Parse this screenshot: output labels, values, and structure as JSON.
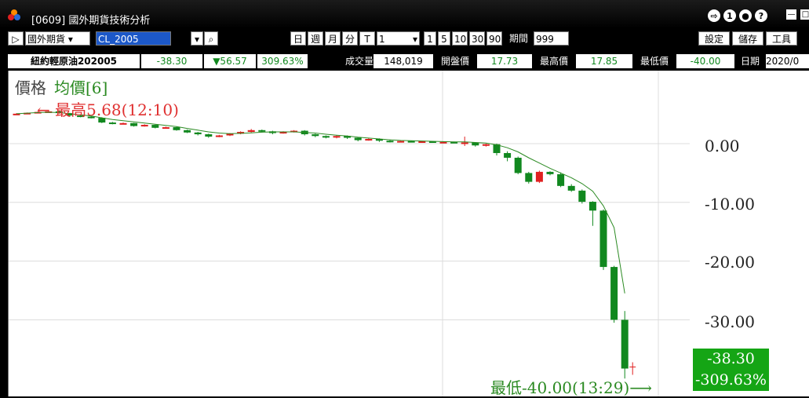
{
  "window": {
    "title": "[0609] 國外期貨技術分析",
    "help_label": "?",
    "info_label": "1",
    "minimize_label": "—"
  },
  "toolbar": {
    "market_select": "國外期貨",
    "symbol_input": "CL_2005",
    "period_buttons": [
      "日",
      "週",
      "月",
      "分",
      "T"
    ],
    "interval_value": "1",
    "minute_buttons": [
      "1",
      "5",
      "10",
      "30",
      "90"
    ],
    "range_label": "期間",
    "range_value": "999",
    "settings_label": "設定",
    "save_label": "儲存",
    "tools_label": "工具"
  },
  "quote": {
    "name": "紐約輕原油202005",
    "last": "-38.30",
    "change": "▼56.57",
    "change_pct": "309.63%",
    "volume_label": "成交量",
    "volume": "148,019",
    "open_label": "開盤價",
    "open": "17.73",
    "high_label": "最高價",
    "high": "17.85",
    "low_label": "最低價",
    "low": "-40.00",
    "date_label": "日期",
    "date": "2020/0"
  },
  "chart_title": {
    "price": "價格",
    "ma": "均價[6]"
  },
  "annotations": {
    "high": "← 最高5.68(12:10)",
    "low": "最低-40.00(13:29)⟶"
  },
  "badge": {
    "price": "-38.30",
    "pct": "-309.63%"
  },
  "colors": {
    "up": "#e02020",
    "down": "#11881f",
    "ma": "#2b8a22",
    "badge": "#15a515"
  },
  "chart_data": {
    "type": "candlestick",
    "title": "價格",
    "ma_label": "均價[6]",
    "y_ticks": [
      "0.00",
      "-10.00",
      "-20.00",
      "-30.00"
    ],
    "ylim": [
      -42,
      9
    ],
    "grid": "vertical",
    "high": 5.68,
    "high_time": "12:10",
    "low": -40.0,
    "low_time": "13:29",
    "last": -38.3,
    "candles": [
      {
        "o": 5.1,
        "c": 5.1,
        "h": 5.2,
        "l": 5.0
      },
      {
        "o": 5.2,
        "c": 5.25,
        "h": 5.3,
        "l": 5.15
      },
      {
        "o": 5.3,
        "c": 5.4,
        "h": 5.5,
        "l": 5.2
      },
      {
        "o": 5.4,
        "c": 5.5,
        "h": 5.68,
        "l": 5.3
      },
      {
        "o": 5.5,
        "c": 5.2,
        "h": 5.55,
        "l": 5.1
      },
      {
        "o": 5.2,
        "c": 4.8,
        "h": 5.25,
        "l": 4.6
      },
      {
        "o": 4.8,
        "c": 4.6,
        "h": 4.9,
        "l": 4.5
      },
      {
        "o": 4.6,
        "c": 4.4,
        "h": 4.7,
        "l": 4.3
      },
      {
        "o": 4.4,
        "c": 3.6,
        "h": 4.5,
        "l": 3.5
      },
      {
        "o": 3.6,
        "c": 3.4,
        "h": 3.7,
        "l": 3.3
      },
      {
        "o": 3.4,
        "c": 3.5,
        "h": 3.6,
        "l": 3.3
      },
      {
        "o": 3.5,
        "c": 3.0,
        "h": 3.55,
        "l": 2.9
      },
      {
        "o": 3.0,
        "c": 3.2,
        "h": 3.3,
        "l": 2.9
      },
      {
        "o": 3.2,
        "c": 2.7,
        "h": 3.25,
        "l": 2.6
      },
      {
        "o": 2.7,
        "c": 2.8,
        "h": 2.9,
        "l": 2.6
      },
      {
        "o": 2.8,
        "c": 2.3,
        "h": 2.85,
        "l": 2.2
      },
      {
        "o": 2.3,
        "c": 1.9,
        "h": 2.4,
        "l": 1.8
      },
      {
        "o": 1.9,
        "c": 1.6,
        "h": 2.0,
        "l": 1.4
      },
      {
        "o": 1.6,
        "c": 1.2,
        "h": 1.7,
        "l": 1.0
      },
      {
        "o": 1.2,
        "c": 1.4,
        "h": 1.5,
        "l": 1.1
      },
      {
        "o": 1.4,
        "c": 1.7,
        "h": 1.8,
        "l": 1.3
      },
      {
        "o": 1.7,
        "c": 2.0,
        "h": 2.1,
        "l": 1.6
      },
      {
        "o": 2.0,
        "c": 2.3,
        "h": 2.5,
        "l": 1.9
      },
      {
        "o": 2.3,
        "c": 2.1,
        "h": 2.4,
        "l": 1.9
      },
      {
        "o": 2.1,
        "c": 1.8,
        "h": 2.2,
        "l": 1.6
      },
      {
        "o": 1.8,
        "c": 2.0,
        "h": 2.1,
        "l": 1.7
      },
      {
        "o": 2.0,
        "c": 2.2,
        "h": 2.3,
        "l": 1.9
      },
      {
        "o": 2.2,
        "c": 1.6,
        "h": 2.3,
        "l": 1.4
      },
      {
        "o": 1.6,
        "c": 1.3,
        "h": 1.7,
        "l": 1.1
      },
      {
        "o": 1.3,
        "c": 1.1,
        "h": 1.4,
        "l": 0.9
      },
      {
        "o": 1.1,
        "c": 1.3,
        "h": 1.4,
        "l": 0.9
      },
      {
        "o": 1.3,
        "c": 1.0,
        "h": 1.4,
        "l": 0.8
      },
      {
        "o": 1.0,
        "c": 0.6,
        "h": 1.1,
        "l": 0.4
      },
      {
        "o": 0.6,
        "c": 0.8,
        "h": 0.9,
        "l": 0.5
      },
      {
        "o": 0.8,
        "c": 0.5,
        "h": 0.9,
        "l": 0.3
      },
      {
        "o": 0.5,
        "c": 0.3,
        "h": 0.6,
        "l": 0.2
      },
      {
        "o": 0.3,
        "c": 0.45,
        "h": 0.5,
        "l": 0.2
      },
      {
        "o": 0.45,
        "c": 0.35,
        "h": 0.5,
        "l": 0.25
      },
      {
        "o": 0.35,
        "c": 0.4,
        "h": 0.45,
        "l": 0.3
      },
      {
        "o": 0.4,
        "c": 0.25,
        "h": 0.45,
        "l": 0.2
      },
      {
        "o": 0.25,
        "c": 0.3,
        "h": 0.4,
        "l": 0.2
      },
      {
        "o": 0.3,
        "c": 0.15,
        "h": 0.35,
        "l": 0.1
      },
      {
        "o": 0.15,
        "c": 0.2,
        "h": 1.2,
        "l": -0.4
      },
      {
        "o": 0.2,
        "c": -0.3,
        "h": 0.25,
        "l": -0.5
      },
      {
        "o": -0.3,
        "c": -0.1,
        "h": 0.0,
        "l": -0.5
      },
      {
        "o": -0.1,
        "c": -1.6,
        "h": 0.0,
        "l": -2.0
      },
      {
        "o": -1.6,
        "c": -2.4,
        "h": -1.3,
        "l": -3.0
      },
      {
        "o": -2.4,
        "c": -5.0,
        "h": -2.2,
        "l": -5.2
      },
      {
        "o": -5.0,
        "c": -6.5,
        "h": -4.8,
        "l": -6.8
      },
      {
        "o": -6.5,
        "c": -4.8,
        "h": -4.6,
        "l": -6.7
      },
      {
        "o": -4.8,
        "c": -5.2,
        "h": -4.7,
        "l": -5.4
      },
      {
        "o": -5.2,
        "c": -7.2,
        "h": -4.9,
        "l": -7.4
      },
      {
        "o": -7.2,
        "c": -8.0,
        "h": -6.9,
        "l": -8.2
      },
      {
        "o": -8.0,
        "c": -9.9,
        "h": -7.8,
        "l": -10.2
      },
      {
        "o": -9.9,
        "c": -11.4,
        "h": -9.8,
        "l": -14.0
      },
      {
        "o": -11.4,
        "c": -21.0,
        "h": -11.2,
        "l": -21.5
      },
      {
        "o": -21.0,
        "c": -30.0,
        "h": -20.8,
        "l": -30.5
      },
      {
        "o": -30.0,
        "c": -38.3,
        "h": -28.5,
        "l": -40.0
      }
    ],
    "ma": [
      5.1,
      5.2,
      5.3,
      5.35,
      5.3,
      5.1,
      4.9,
      4.7,
      4.4,
      4.1,
      3.9,
      3.7,
      3.5,
      3.3,
      3.1,
      2.9,
      2.6,
      2.3,
      2.0,
      1.8,
      1.7,
      1.75,
      1.85,
      1.95,
      2.0,
      2.0,
      2.0,
      1.9,
      1.8,
      1.6,
      1.45,
      1.3,
      1.1,
      0.95,
      0.8,
      0.65,
      0.55,
      0.5,
      0.45,
      0.4,
      0.35,
      0.3,
      0.3,
      0.2,
      0.1,
      -0.2,
      -0.7,
      -1.4,
      -2.4,
      -3.3,
      -4.2,
      -5.0,
      -5.8,
      -6.8,
      -8.1,
      -10.6,
      -14.3,
      -25.5
    ]
  }
}
